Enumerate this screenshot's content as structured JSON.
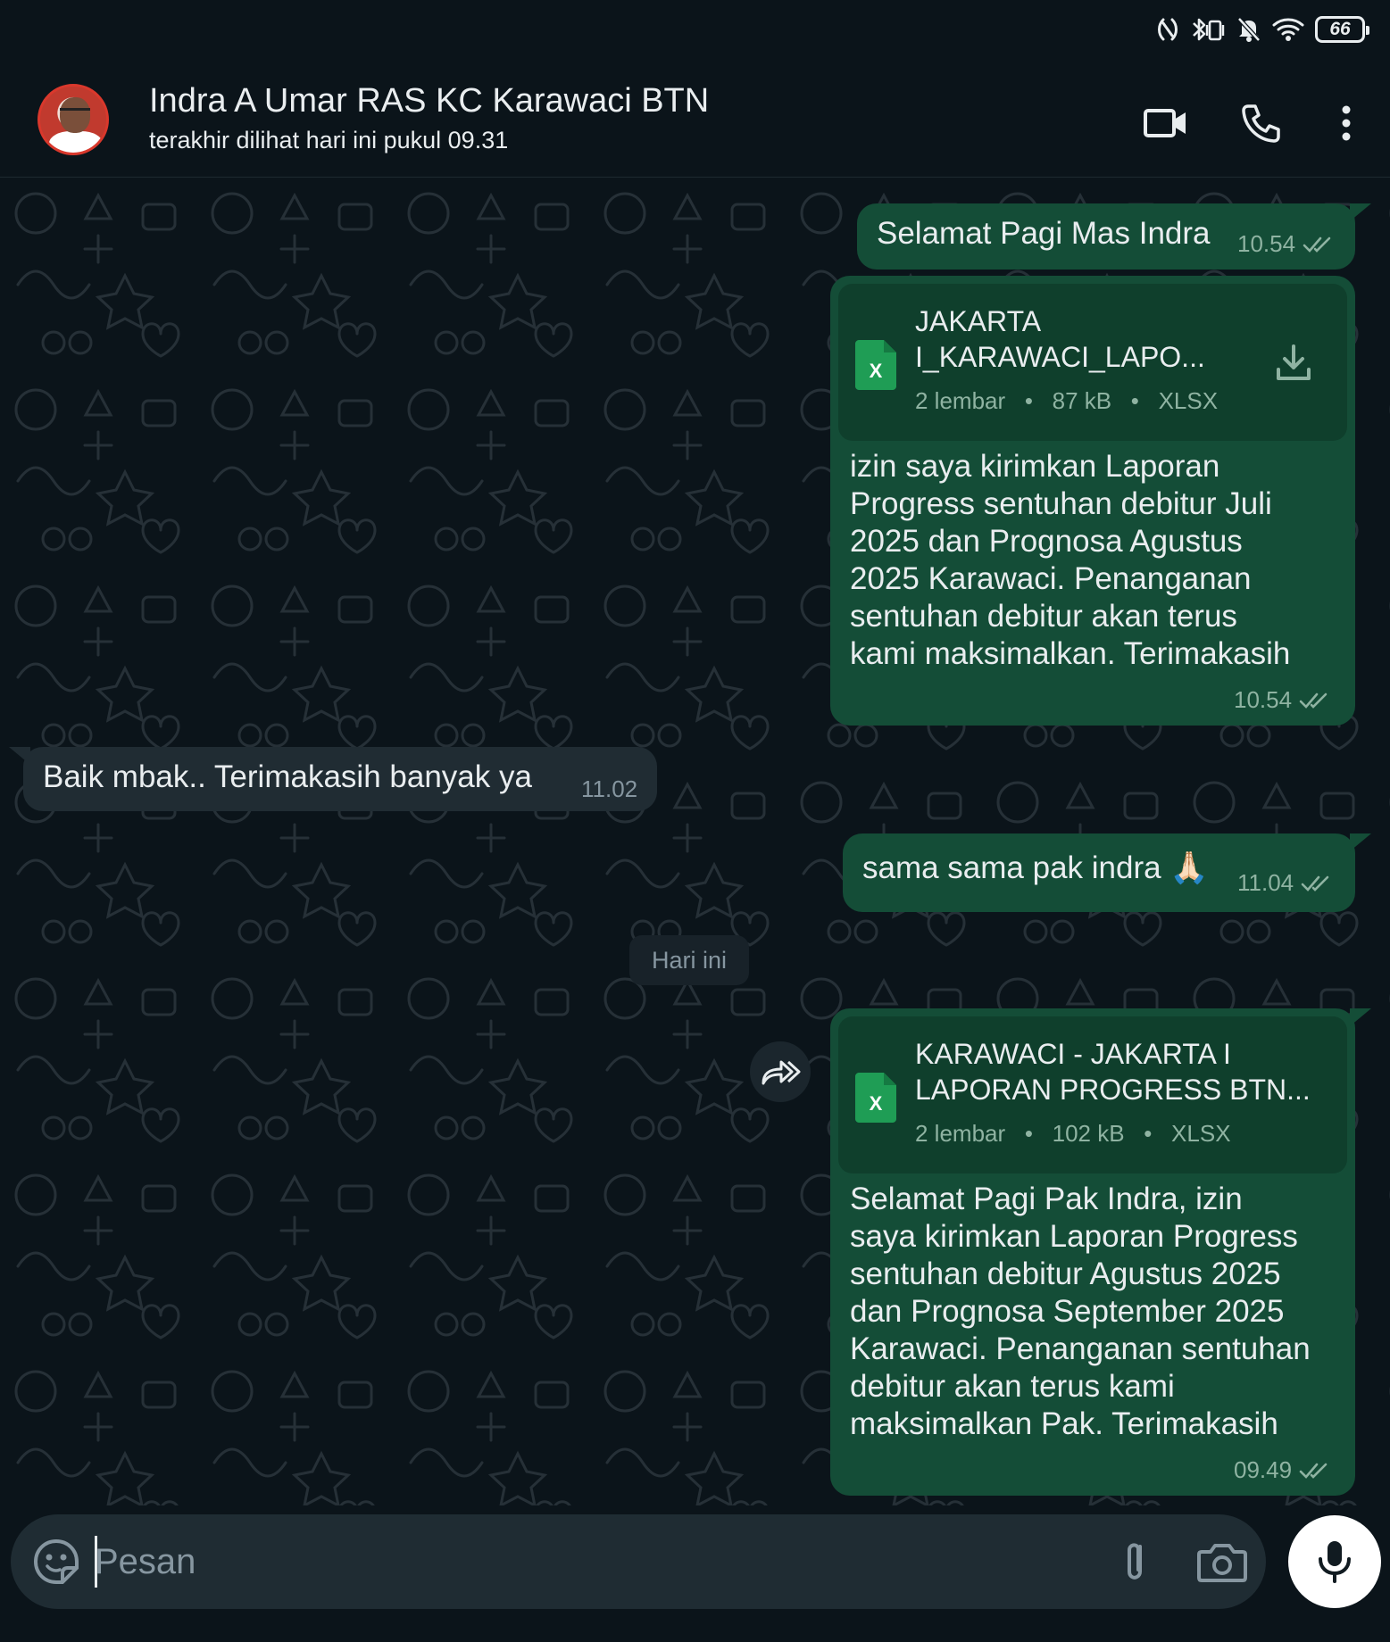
{
  "status_bar": {
    "battery_level": "66",
    "icons": [
      "nfc-icon",
      "bluetooth-icon",
      "vibrate-icon",
      "bell-off-icon",
      "wifi-icon",
      "battery-icon"
    ]
  },
  "header": {
    "contact_name": "Indra A Umar RAS KC Karawaci BTN",
    "last_seen": "terakhir dilihat hari ini pukul 09.31",
    "actions": [
      "video-call-icon",
      "phone-icon",
      "more-vert-icon"
    ]
  },
  "messages": [
    {
      "direction": "outgoing",
      "text": "Selamat Pagi Mas Indra",
      "time": "10.54",
      "status": "read"
    },
    {
      "direction": "outgoing",
      "document": {
        "name_line1": "JAKARTA",
        "name_line2": "I_KARAWACI_LAPO...",
        "pages": "2 lembar",
        "size": "87 kB",
        "type": "XLSX"
      },
      "caption_lines": [
        "izin saya kirimkan Laporan",
        "Progress sentuhan debitur Juli",
        "2025 dan Prognosa Agustus",
        "2025 Karawaci. Penanganan",
        "sentuhan debitur akan terus",
        "kami maksimalkan. Terimakasih"
      ],
      "time": "10.54",
      "status": "read"
    },
    {
      "direction": "incoming",
      "text": "Baik mbak.. Terimakasih banyak ya",
      "time": "11.02"
    },
    {
      "direction": "outgoing",
      "text": "sama sama pak indra 🙏🏻",
      "time": "11.04",
      "status": "read"
    },
    {
      "type": "date_divider",
      "text": "Hari ini"
    },
    {
      "direction": "outgoing",
      "document": {
        "name_line1": "KARAWACI - JAKARTA I",
        "name_line2": "LAPORAN PROGRESS BTN...",
        "pages": "2 lembar",
        "size": "102 kB",
        "type": "XLSX"
      },
      "caption_lines": [
        "Selamat Pagi Pak Indra, izin",
        "saya kirimkan Laporan Progress",
        "sentuhan debitur Agustus 2025",
        "dan Prognosa September 2025",
        "Karawaci. Penanganan sentuhan",
        "debitur akan terus kami",
        "maksimalkan Pak. Terimakasih"
      ],
      "time": "09.49",
      "status": "read"
    }
  ],
  "input": {
    "placeholder": "Pesan",
    "icons": [
      "sticker-icon",
      "attach-icon",
      "camera-icon",
      "mic-icon"
    ]
  },
  "colors": {
    "background": "#0b141a",
    "outgoing_bubble": "#144d37",
    "incoming_bubble": "#202c33",
    "input_bar": "#1f2c33",
    "mic_button": "#ffffff",
    "excel_green": "#1f9d55"
  }
}
